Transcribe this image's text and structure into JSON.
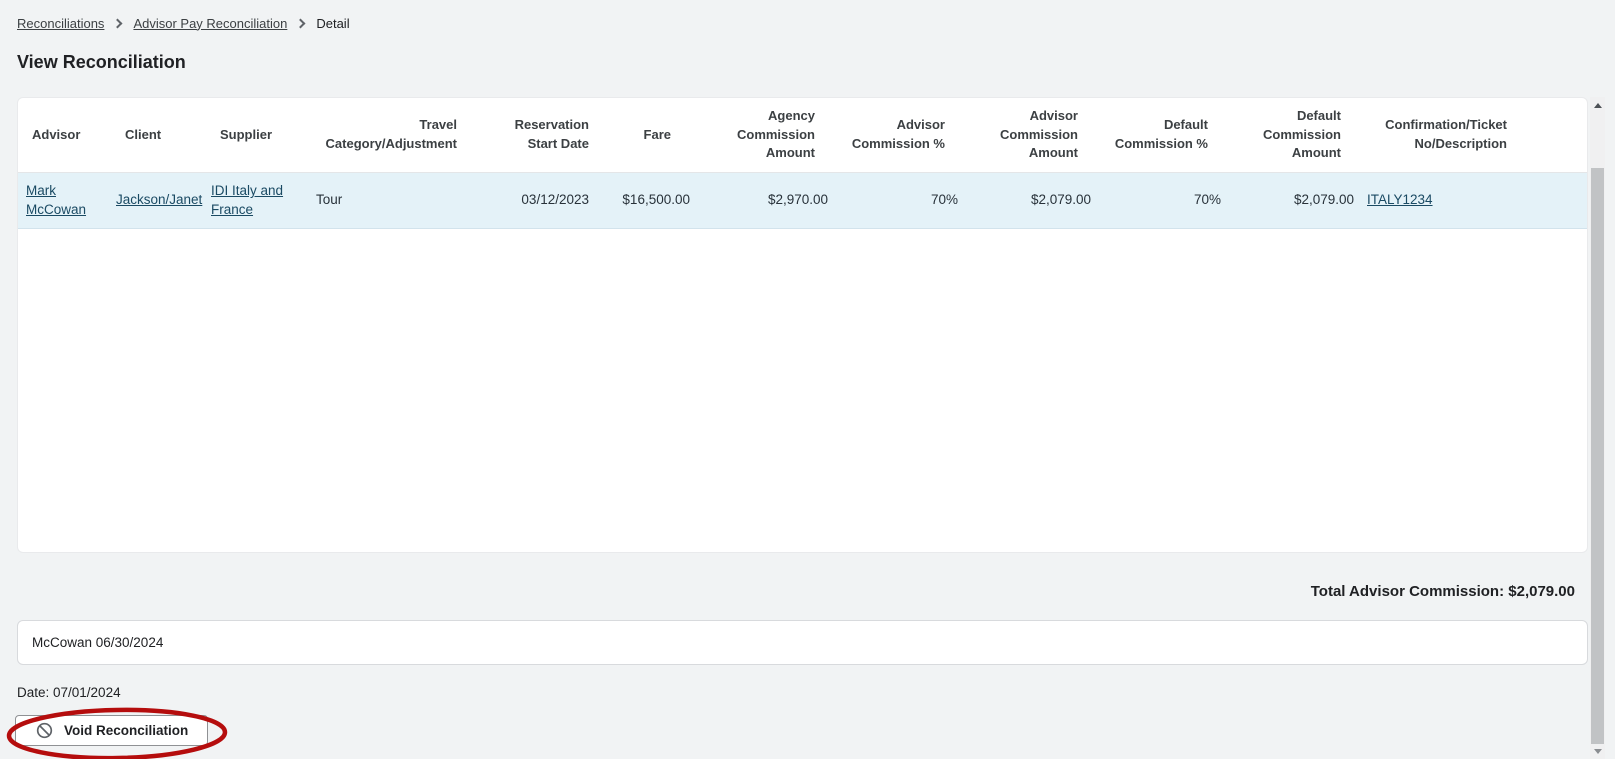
{
  "breadcrumb": {
    "items": [
      {
        "label": "Reconciliations"
      },
      {
        "label": "Advisor Pay Reconciliation"
      },
      {
        "label": "Detail"
      }
    ]
  },
  "page": {
    "title": "View Reconciliation"
  },
  "table": {
    "columns": [
      {
        "label": "Advisor"
      },
      {
        "label": "Client"
      },
      {
        "label": "Supplier"
      },
      {
        "label": "Travel\nCategory/Adjustment"
      },
      {
        "label": "Reservation\nStart Date"
      },
      {
        "label": "Fare"
      },
      {
        "label": "Agency\nCommission\nAmount"
      },
      {
        "label": "Advisor\nCommission %"
      },
      {
        "label": "Advisor\nCommission\nAmount"
      },
      {
        "label": "Default\nCommission %"
      },
      {
        "label": "Default\nCommission\nAmount"
      },
      {
        "label": "Confirmation/Ticket\nNo/Description"
      }
    ],
    "rows": [
      {
        "advisor": "Mark McCowan",
        "client": "Jackson/Janet",
        "supplier": "IDI Italy and France",
        "travel_category": "Tour",
        "reservation_start_date": "03/12/2023",
        "fare": "$16,500.00",
        "agency_commission_amount": "$2,970.00",
        "advisor_commission_percent": "70%",
        "advisor_commission_amount": "$2,079.00",
        "default_commission_percent": "70%",
        "default_commission_amount": "$2,079.00",
        "confirmation_ticket": "ITALY1234"
      }
    ]
  },
  "summary": {
    "total": "Total Advisor Commission: $2,079.00"
  },
  "signature": {
    "value": "McCowan 06/30/2024"
  },
  "footer": {
    "date_label": "Date: 07/01/2024"
  },
  "actions": {
    "void_label": "Void Reconciliation"
  },
  "colors": {
    "link": "#1a4a63",
    "row_highlight": "#e4f2f8",
    "annotation_red": "#b50d0d",
    "page_background": "#f1f3f4",
    "scrollbar_thumb": "#c1c3c5"
  }
}
